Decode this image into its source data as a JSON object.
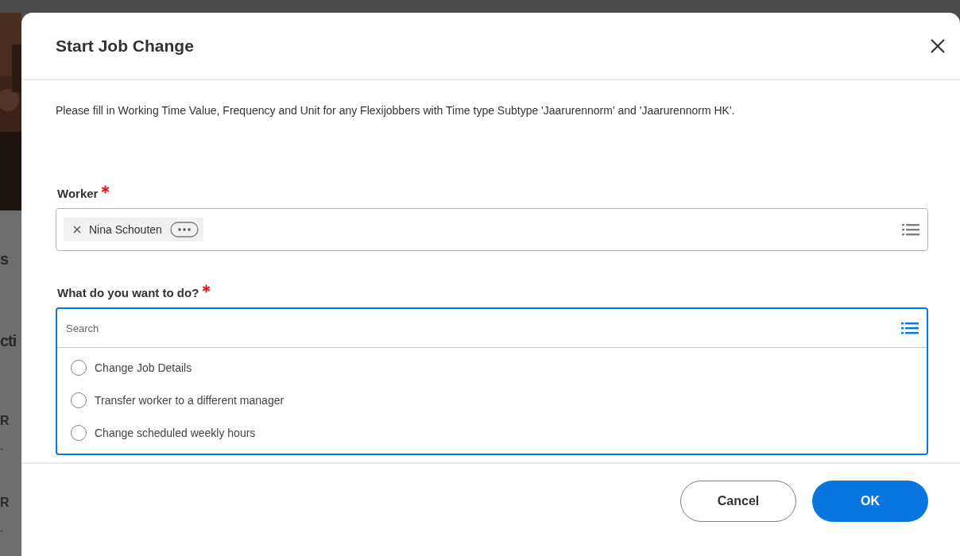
{
  "background_page": {
    "fragments": [
      {
        "text": "s",
        "kind": "heading"
      },
      {
        "text": "cti",
        "kind": "heading"
      },
      {
        "text": "R",
        "kind": "item"
      },
      {
        "text": "-",
        "kind": "sub"
      },
      {
        "text": "R",
        "kind": "item"
      },
      {
        "text": "-",
        "kind": "sub"
      }
    ]
  },
  "dialog": {
    "title": "Start Job Change",
    "instructions": "Please fill in Working Time Value, Frequency and Unit for any Flexijobbers with Time type Subtype 'Jaarurennorm' and 'Jaarurennorm HK'.",
    "fields": [
      {
        "label": "Worker",
        "required": true,
        "focused": false,
        "tokens": [
          "Nina Schouten"
        ]
      },
      {
        "label": "What do you want to do?",
        "required": true,
        "focused": true,
        "search_placeholder": "Search",
        "options": [
          {
            "label": "Change Job Details",
            "selected": false
          },
          {
            "label": "Transfer worker to a different manager",
            "selected": false
          },
          {
            "label": "Change scheduled weekly hours",
            "selected": false
          }
        ]
      }
    ],
    "buttons": [
      {
        "label": "Cancel",
        "kind": "secondary"
      },
      {
        "label": "OK",
        "kind": "primary"
      }
    ]
  }
}
